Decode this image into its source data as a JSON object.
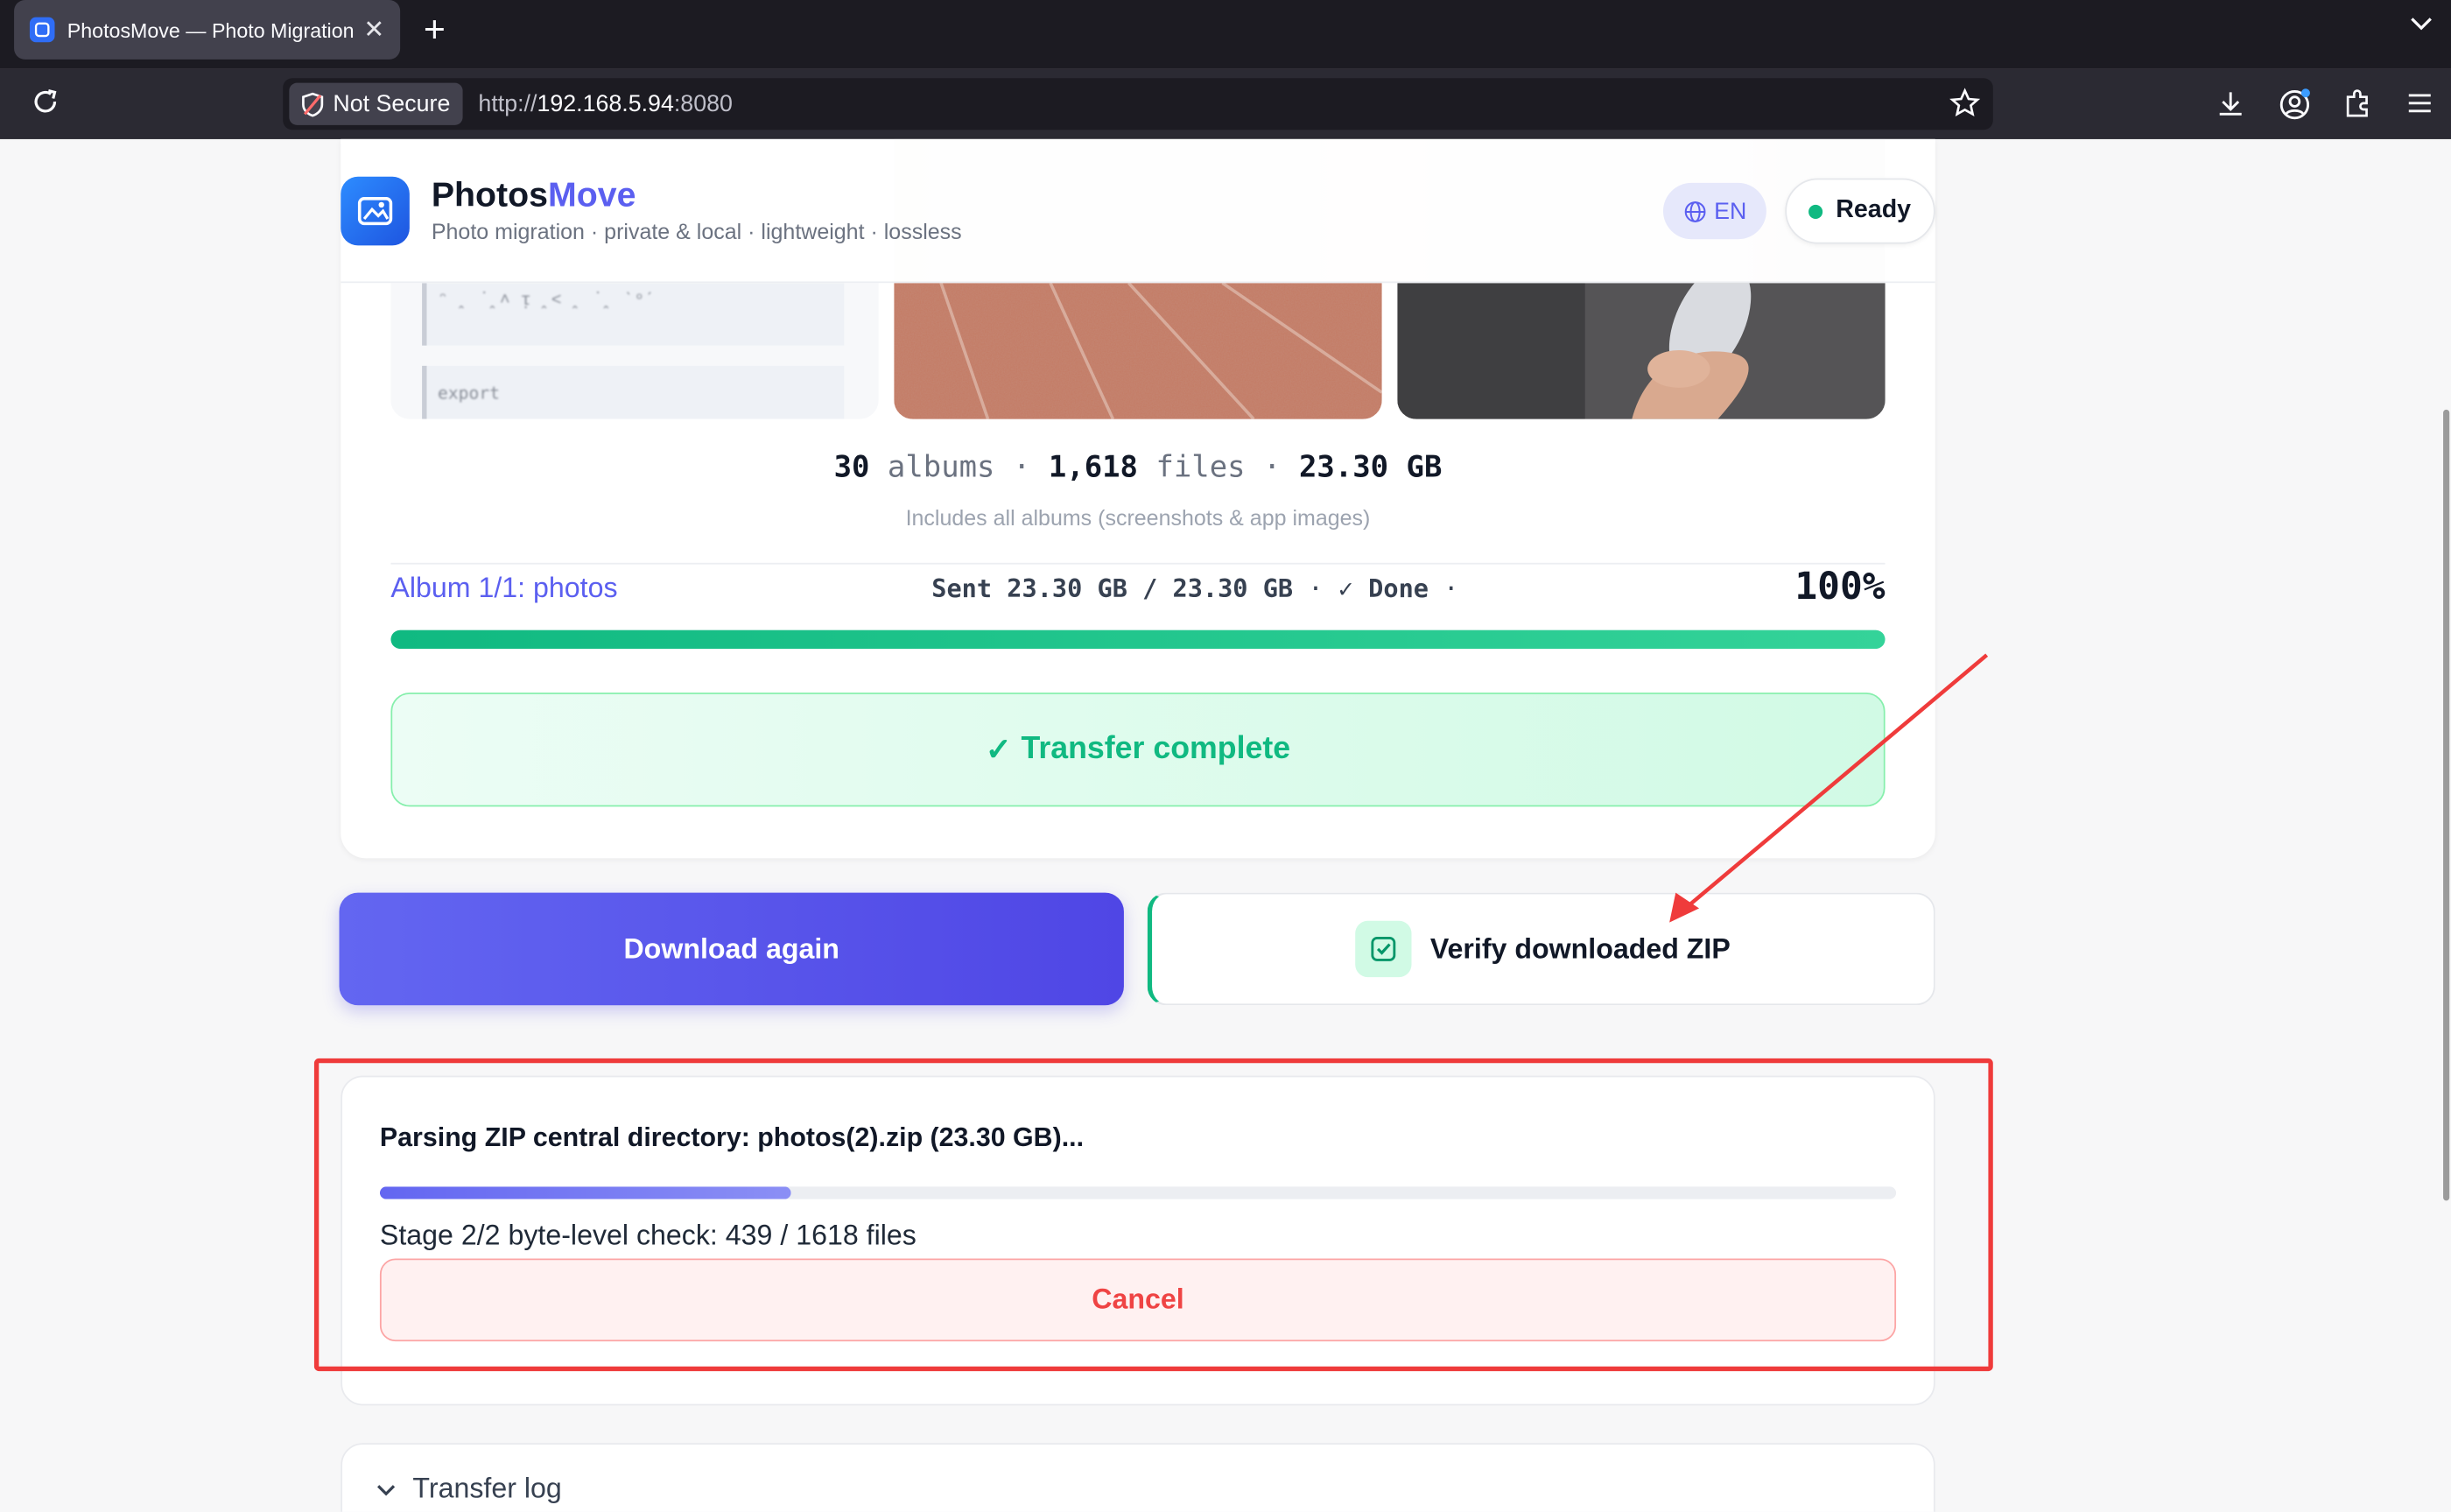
{
  "browser": {
    "tab_title": "PhotosMove — Photo Migration",
    "security_label": "Not Secure",
    "url_scheme": "http://",
    "url_host": "192.168.5.94",
    "url_port": ":8080"
  },
  "header": {
    "brand_main": "Photos",
    "brand_accent": "Move",
    "tagline": "Photo migration · private & local · lightweight · lossless",
    "lang_label": "EN",
    "status_label": "Ready"
  },
  "thumbnails": {
    "doc_line1": "ᵔ ꞈ ˙ꞈ˄ ᴉ ꞈ˂ ꞈ ˙ꞈ ˋᵒˊ",
    "doc_line2": "export"
  },
  "summary": {
    "albums_count": "30",
    "albums_label": "albums",
    "files_count": "1,618",
    "files_label": "files",
    "size": "23.30 GB",
    "sep": "·",
    "note": "Includes all albums (screenshots & app images)"
  },
  "progress": {
    "album_label": "Album 1/1: photos",
    "sent_text": "Sent 23.30 GB / 23.30 GB",
    "done_text": "✓ Done",
    "sep": "·",
    "percent_label": "100%",
    "fraction": 1.0,
    "complete_label": "Transfer complete",
    "complete_icon": "check-icon"
  },
  "actions": {
    "download_again_label": "Download again",
    "verify_label": "Verify downloaded ZIP"
  },
  "verify": {
    "title": "Parsing ZIP central directory: photos(2).zip (23.30 GB)...",
    "stage_text": "Stage 2/2 byte-level check: 439 / 1618 files",
    "checked_files": 439,
    "total_files": 1618,
    "cancel_label": "Cancel"
  },
  "log": {
    "title": "Transfer log"
  },
  "colors": {
    "accent": "#5b5ff0",
    "success": "#10b981",
    "danger": "#ef4444",
    "annotation": "#ef3b3b"
  }
}
